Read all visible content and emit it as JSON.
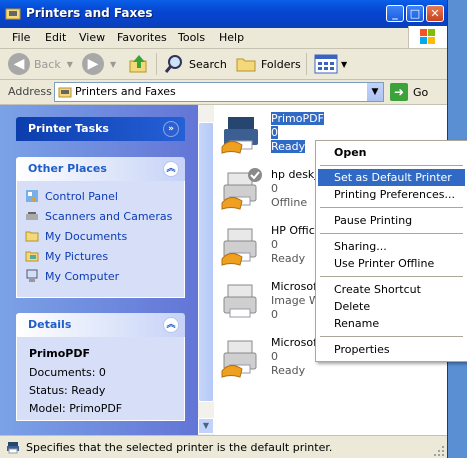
{
  "window": {
    "title": "Printers and Faxes",
    "buttons": {
      "minimize": "_",
      "maximize": "□",
      "close": "✕"
    }
  },
  "menubar": {
    "items": [
      "File",
      "Edit",
      "View",
      "Favorites",
      "Tools",
      "Help"
    ]
  },
  "toolbar": {
    "back_label": "Back",
    "search_label": "Search",
    "folders_label": "Folders"
  },
  "address": {
    "label": "Address",
    "value": "Printers and Faxes",
    "go_label": "Go"
  },
  "taskpane": {
    "printer_tasks": {
      "title": "Printer Tasks"
    },
    "other_places": {
      "title": "Other Places",
      "links": [
        {
          "label": "Control Panel",
          "icon": "control-panel-icon"
        },
        {
          "label": "Scanners and Cameras",
          "icon": "scanner-icon"
        },
        {
          "label": "My Documents",
          "icon": "folder-icon"
        },
        {
          "label": "My Pictures",
          "icon": "pictures-folder-icon"
        },
        {
          "label": "My Computer",
          "icon": "computer-icon"
        }
      ]
    },
    "details": {
      "title": "Details",
      "name": "PrimoPDF",
      "documents": "Documents: 0",
      "status": "Status: Ready",
      "model": "Model: PrimoPDF"
    }
  },
  "printers": [
    {
      "name": "PrimoPDF",
      "docs": "0",
      "status": "Ready",
      "selected": true
    },
    {
      "name": "hp deskje",
      "docs": "0",
      "status": "Offline",
      "selected": false
    },
    {
      "name": "HP Office",
      "docs": "0",
      "status": "Ready",
      "selected": false
    },
    {
      "name": "Microsoft",
      "line2": "Image W",
      "docs": "0",
      "status": "",
      "selected": false
    },
    {
      "name": "Microsoft",
      "docs": "0",
      "status": "Ready",
      "selected": false
    }
  ],
  "context_menu": {
    "items": [
      {
        "label": "Open",
        "bold": true
      },
      {
        "label": "Set as Default Printer",
        "highlighted": true
      },
      {
        "label": "Printing Preferences..."
      },
      {
        "label": "Pause Printing"
      },
      {
        "label": "Sharing..."
      },
      {
        "label": "Use Printer Offline"
      },
      {
        "label": "Create Shortcut"
      },
      {
        "label": "Delete"
      },
      {
        "label": "Rename"
      },
      {
        "label": "Properties"
      }
    ]
  },
  "statusbar": {
    "text": "Specifies that the selected printer is the default printer."
  },
  "colors": {
    "titlebar": "#0a5fe8",
    "selection": "#316ac5",
    "taskpane": "#7ba2e7"
  }
}
